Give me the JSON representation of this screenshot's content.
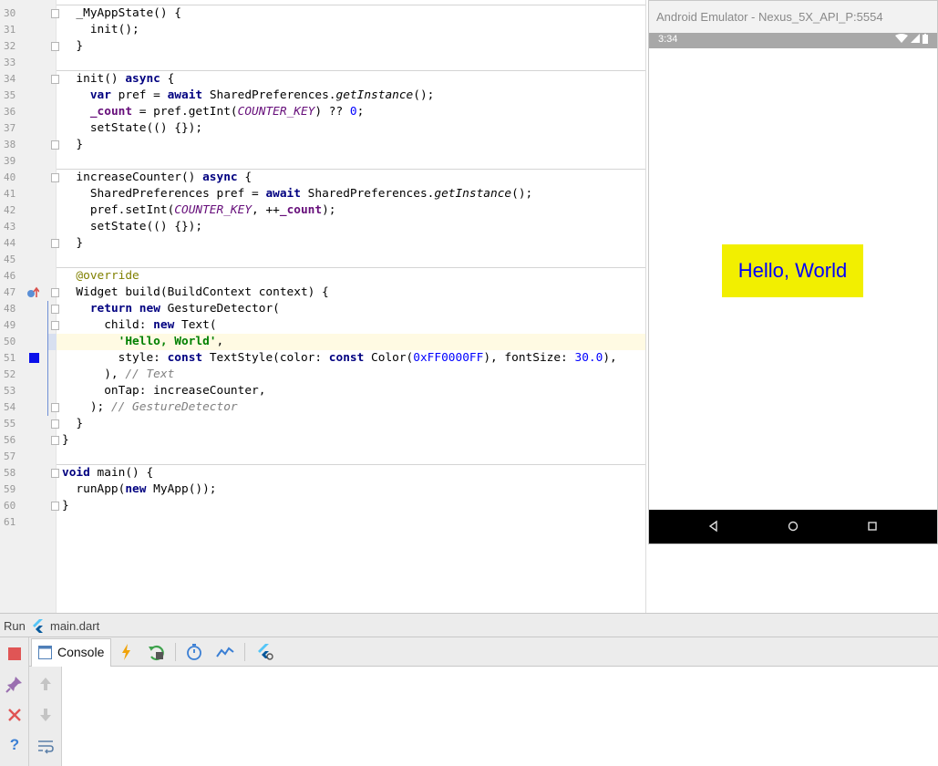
{
  "editor": {
    "lines": [
      {
        "num": "30",
        "code": "  _MyAppState() {"
      },
      {
        "num": "31",
        "code": "    init();"
      },
      {
        "num": "32",
        "code": "  }"
      },
      {
        "num": "33",
        "code": ""
      },
      {
        "num": "34",
        "code": "  init() async {"
      },
      {
        "num": "35",
        "code": "    var pref = await SharedPreferences.getInstance();"
      },
      {
        "num": "36",
        "code": "    _count = pref.getInt(COUNTER_KEY) ?? 0;"
      },
      {
        "num": "37",
        "code": "    setState(() {});"
      },
      {
        "num": "38",
        "code": "  }"
      },
      {
        "num": "39",
        "code": ""
      },
      {
        "num": "40",
        "code": "  increaseCounter() async {"
      },
      {
        "num": "41",
        "code": "    SharedPreferences pref = await SharedPreferences.getInstance();"
      },
      {
        "num": "42",
        "code": "    pref.setInt(COUNTER_KEY, ++_count);"
      },
      {
        "num": "43",
        "code": "    setState(() {});"
      },
      {
        "num": "44",
        "code": "  }"
      },
      {
        "num": "45",
        "code": ""
      },
      {
        "num": "46",
        "code": "  @override"
      },
      {
        "num": "47",
        "code": "  Widget build(BuildContext context) {"
      },
      {
        "num": "48",
        "code": "    return new GestureDetector("
      },
      {
        "num": "49",
        "code": "      child: new Text("
      },
      {
        "num": "50",
        "code": "        'Hello, World',"
      },
      {
        "num": "51",
        "code": "        style: const TextStyle(color: const Color(0xFF0000FF), fontSize: 30.0),"
      },
      {
        "num": "52",
        "code": "      ), // Text"
      },
      {
        "num": "53",
        "code": "      onTap: increaseCounter,"
      },
      {
        "num": "54",
        "code": "    ); // GestureDetector"
      },
      {
        "num": "55",
        "code": "  }"
      },
      {
        "num": "56",
        "code": "}"
      },
      {
        "num": "57",
        "code": ""
      },
      {
        "num": "58",
        "code": "void main() {"
      },
      {
        "num": "59",
        "code": "  runApp(new MyApp());"
      },
      {
        "num": "60",
        "code": "}"
      },
      {
        "num": "61",
        "code": ""
      }
    ]
  },
  "emulator": {
    "title": "Android Emulator - Nexus_5X_API_P:5554",
    "time": "3:34",
    "hello_text": "Hello, World"
  },
  "run_panel": {
    "run_label": "Run",
    "file": "main.dart",
    "console_tab": "Console"
  },
  "colors": {
    "highlight_yellow": "#f2ef00",
    "hello_text_blue": "#0000ff",
    "keyword_navy": "#000080",
    "string_green": "#008000",
    "current_line": "#fffae3"
  }
}
